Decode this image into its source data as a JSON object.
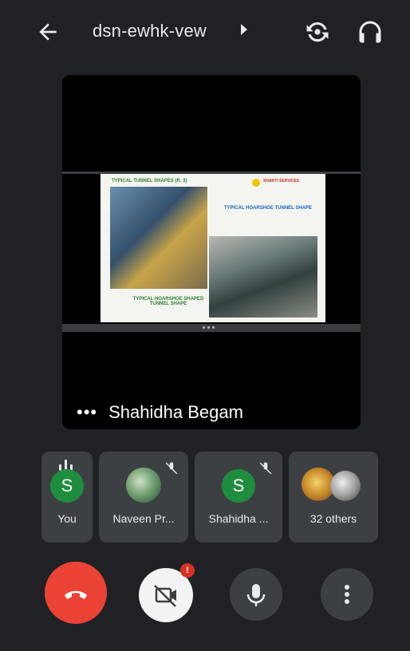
{
  "header": {
    "meeting_code": "dsn-ewhk-vew",
    "back_icon": "arrow-left-icon",
    "switch_camera_icon": "camera-switch-icon",
    "audio_output_icon": "headphones-icon"
  },
  "presentation": {
    "slide_title_top_left": "TYPICAL TUNNEL SHAPES (R. 3)",
    "slide_caption_right": "TYPICAL HOARSHOE TUNNEL SHAPE",
    "slide_caption_left": "TYPICAL HOARSHOE SHAPED TUNNEL SHAPE",
    "slide_logo_text": "SHAKTI SERVICES"
  },
  "speaker": {
    "more_label": "•••",
    "name": "Shahidha Begam"
  },
  "participants": [
    {
      "label": "You",
      "avatar_letter": "S",
      "status": "speaking"
    },
    {
      "label": "Naveen Pr...",
      "avatar": "photo",
      "status": "muted"
    },
    {
      "label": "Shahidha ...",
      "avatar_letter": "S",
      "status": "muted"
    },
    {
      "label": "32 others",
      "avatar": "group"
    }
  ],
  "controls": {
    "end_call_icon": "phone-hangup-icon",
    "camera_icon": "camera-off-icon",
    "camera_badge": "!",
    "mic_icon": "microphone-icon",
    "more_icon": "more-vertical-icon"
  },
  "colors": {
    "background": "#202124",
    "tile": "#3c4043",
    "avatar_green": "#1e8e3e",
    "end_call_red": "#ea4335"
  }
}
